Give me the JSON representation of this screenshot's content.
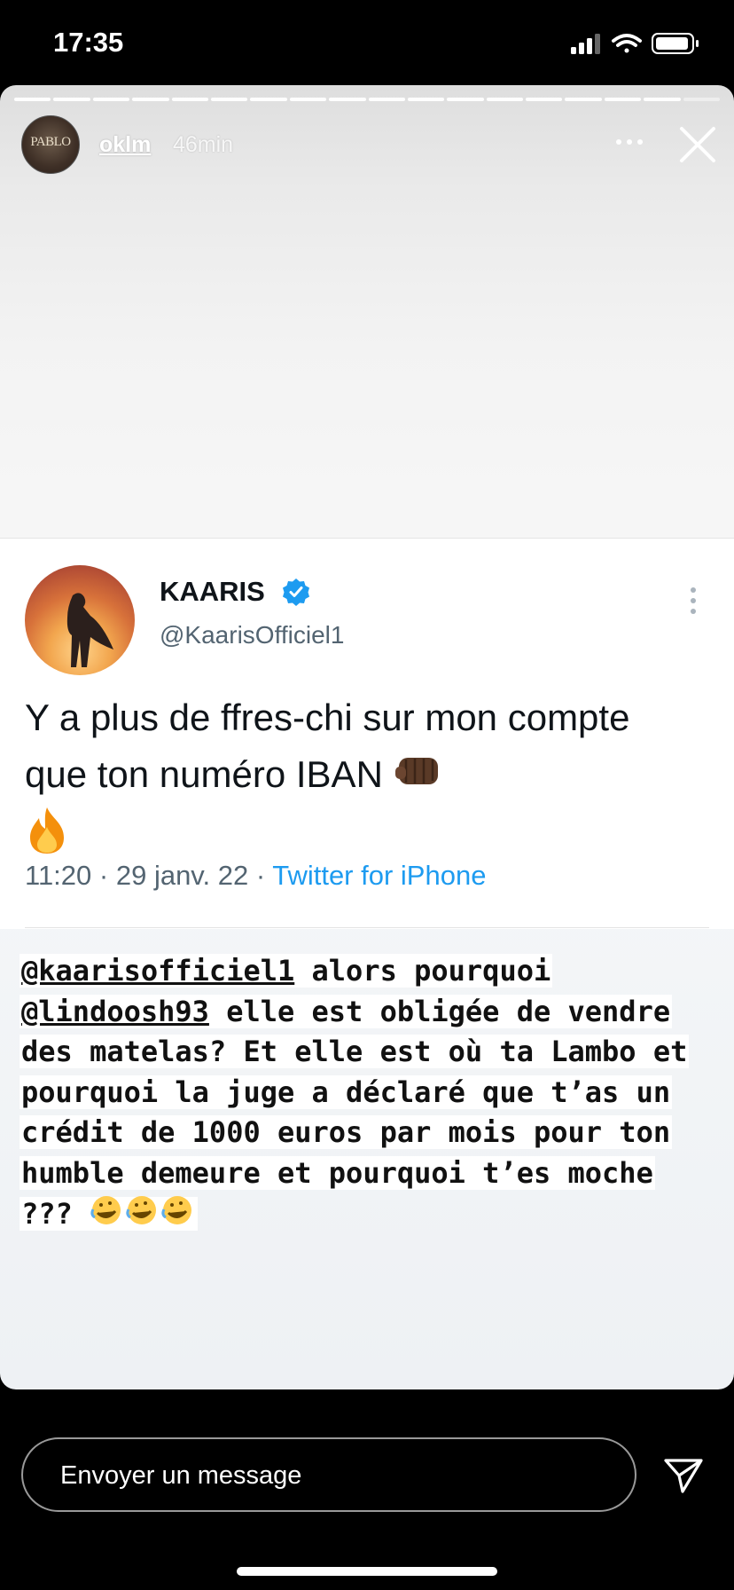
{
  "status_bar": {
    "time": "17:35"
  },
  "story": {
    "progress": {
      "segments": 18,
      "filled": 17
    },
    "header": {
      "avatar_text": "PABLO",
      "username": "oklm",
      "time_ago": "46min"
    },
    "tweet": {
      "display_name": "KAARIS",
      "handle": "@KaarisOfficiel1",
      "text": "Y a plus de ffres-chi sur mon compte que ton numéro IBAN",
      "time": "11:20",
      "date": "29 janv. 22",
      "source": "Twitter for iPhone",
      "separator": " · "
    },
    "caption": {
      "mention1": "@kaarisofficiel1",
      "part1": " alors pourquoi ",
      "mention2": "@lindoosh93",
      "part2": " elle est obligée de vendre des matelas? Et elle est où ta Lambo et pourquoi la juge a déclaré que t’as un crédit de 1000 euros par mois pour ton humble demeure et pourquoi t’es moche ???"
    }
  },
  "reply_bar": {
    "placeholder": "Envoyer un message"
  },
  "colors": {
    "verified": "#1d9bf0",
    "link": "#1d9bf0",
    "muted": "#536471"
  }
}
